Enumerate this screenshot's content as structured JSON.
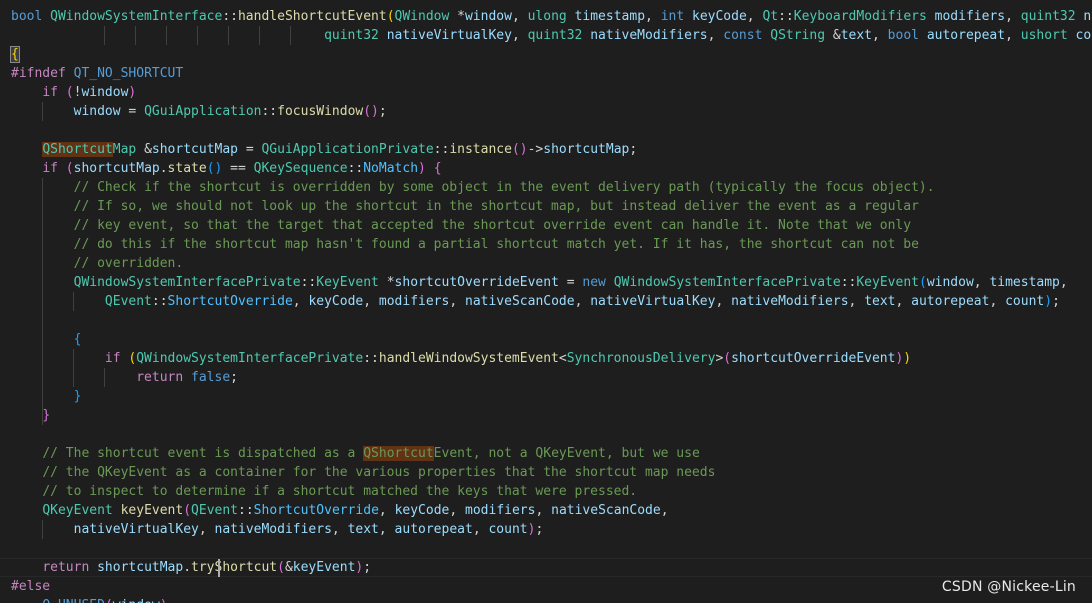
{
  "colors": {
    "background": "#1e1e1e",
    "keyword": "#569cd6",
    "control": "#c586c0",
    "type": "#4ec9b0",
    "function": "#dcdcaa",
    "variable": "#9cdcfe",
    "comment": "#6a9955",
    "text": "#d4d4d4",
    "enum_member": "#4fc1ff",
    "bracket_gold": "#ffd700",
    "bracket_purple": "#da70d6",
    "bracket_blue": "#179fff",
    "search_highlight": "#613214"
  },
  "code_lines": [
    [
      [
        "bool",
        "#569cd6"
      ],
      [
        " ",
        "#d4d4d4"
      ],
      [
        "QWindowSystemInterface",
        "#4ec9b0"
      ],
      [
        "::",
        "#d4d4d4"
      ],
      [
        "handleShortcutEvent",
        "#dcdcaa"
      ],
      [
        "(",
        "#ffd700"
      ],
      [
        "QWindow",
        "#4ec9b0"
      ],
      [
        " *",
        "#d4d4d4"
      ],
      [
        "window",
        "#9cdcfe"
      ],
      [
        ", ",
        "#d4d4d4"
      ],
      [
        "ulong",
        "#4ec9b0"
      ],
      [
        " ",
        "#d4d4d4"
      ],
      [
        "timestamp",
        "#9cdcfe"
      ],
      [
        ", ",
        "#d4d4d4"
      ],
      [
        "int",
        "#569cd6"
      ],
      [
        " ",
        "#d4d4d4"
      ],
      [
        "keyCode",
        "#9cdcfe"
      ],
      [
        ", ",
        "#d4d4d4"
      ],
      [
        "Qt",
        "#4ec9b0"
      ],
      [
        "::",
        "#d4d4d4"
      ],
      [
        "KeyboardModifiers",
        "#4ec9b0"
      ],
      [
        " ",
        "#d4d4d4"
      ],
      [
        "modifiers",
        "#9cdcfe"
      ],
      [
        ", ",
        "#d4d4d4"
      ],
      [
        "quint32",
        "#4ec9b0"
      ],
      [
        " ",
        "#d4d4d4"
      ],
      [
        "nati",
        "#9cdcfe"
      ]
    ],
    [
      [
        "                                        ",
        "#d4d4d4"
      ],
      [
        "quint32",
        "#4ec9b0"
      ],
      [
        " ",
        "#d4d4d4"
      ],
      [
        "nativeVirtualKey",
        "#9cdcfe"
      ],
      [
        ", ",
        "#d4d4d4"
      ],
      [
        "quint32",
        "#4ec9b0"
      ],
      [
        " ",
        "#d4d4d4"
      ],
      [
        "nativeModifiers",
        "#9cdcfe"
      ],
      [
        ", ",
        "#d4d4d4"
      ],
      [
        "const",
        "#569cd6"
      ],
      [
        " ",
        "#d4d4d4"
      ],
      [
        "QString",
        "#4ec9b0"
      ],
      [
        " &",
        "#d4d4d4"
      ],
      [
        "text",
        "#9cdcfe"
      ],
      [
        ", ",
        "#d4d4d4"
      ],
      [
        "bool",
        "#569cd6"
      ],
      [
        " ",
        "#d4d4d4"
      ],
      [
        "autorepeat",
        "#9cdcfe"
      ],
      [
        ", ",
        "#d4d4d4"
      ],
      [
        "ushort",
        "#4ec9b0"
      ],
      [
        " ",
        "#d4d4d4"
      ],
      [
        "count",
        "#9cdcfe"
      ],
      [
        ")",
        "#ffd700"
      ]
    ],
    [
      [
        "{",
        "#ffd700"
      ]
    ],
    [
      [
        "#ifndef",
        "#c586c0"
      ],
      [
        " ",
        "#d4d4d4"
      ],
      [
        "QT_NO_SHORTCUT",
        "#569cd6"
      ]
    ],
    [
      [
        "    ",
        "#d4d4d4"
      ],
      [
        "if",
        "#c586c0"
      ],
      [
        " ",
        "#d4d4d4"
      ],
      [
        "(",
        "#da70d6"
      ],
      [
        "!",
        "#d4d4d4"
      ],
      [
        "window",
        "#9cdcfe"
      ],
      [
        ")",
        "#da70d6"
      ]
    ],
    [
      [
        "        ",
        "#d4d4d4"
      ],
      [
        "window",
        "#9cdcfe"
      ],
      [
        " = ",
        "#d4d4d4"
      ],
      [
        "QGuiApplication",
        "#4ec9b0"
      ],
      [
        "::",
        "#d4d4d4"
      ],
      [
        "focusWindow",
        "#dcdcaa"
      ],
      [
        "()",
        "#da70d6"
      ],
      [
        ";",
        "#d4d4d4"
      ]
    ],
    [
      [
        "",
        "#d4d4d4"
      ]
    ],
    [
      [
        "    ",
        "#d4d4d4"
      ],
      [
        "QShortcut",
        "#4ec9b0"
      ],
      [
        "Map",
        "#4ec9b0"
      ],
      [
        " &",
        "#d4d4d4"
      ],
      [
        "shortcutMap",
        "#9cdcfe"
      ],
      [
        " = ",
        "#d4d4d4"
      ],
      [
        "QGuiApplicationPrivate",
        "#4ec9b0"
      ],
      [
        "::",
        "#d4d4d4"
      ],
      [
        "instance",
        "#dcdcaa"
      ],
      [
        "()",
        "#da70d6"
      ],
      [
        "->",
        "#d4d4d4"
      ],
      [
        "shortcutMap",
        "#9cdcfe"
      ],
      [
        ";",
        "#d4d4d4"
      ]
    ],
    [
      [
        "    ",
        "#d4d4d4"
      ],
      [
        "if",
        "#c586c0"
      ],
      [
        " ",
        "#d4d4d4"
      ],
      [
        "(",
        "#da70d6"
      ],
      [
        "shortcutMap",
        "#9cdcfe"
      ],
      [
        ".",
        "#d4d4d4"
      ],
      [
        "state",
        "#dcdcaa"
      ],
      [
        "()",
        "#179fff"
      ],
      [
        " == ",
        "#d4d4d4"
      ],
      [
        "QKeySequence",
        "#4ec9b0"
      ],
      [
        "::",
        "#d4d4d4"
      ],
      [
        "NoMatch",
        "#4fc1ff"
      ],
      [
        ")",
        "#da70d6"
      ],
      [
        " ",
        "#d4d4d4"
      ],
      [
        "{",
        "#da70d6"
      ]
    ],
    [
      [
        "        ",
        "#d4d4d4"
      ],
      [
        "// Check if the shortcut is overridden by some object in the event delivery path (typically the focus object).",
        "#6a9955"
      ]
    ],
    [
      [
        "        ",
        "#d4d4d4"
      ],
      [
        "// If so, we should not look up the shortcut in the shortcut map, but instead deliver the event as a regular",
        "#6a9955"
      ]
    ],
    [
      [
        "        ",
        "#d4d4d4"
      ],
      [
        "// key event, so that the target that accepted the shortcut override event can handle it. Note that we only",
        "#6a9955"
      ]
    ],
    [
      [
        "        ",
        "#d4d4d4"
      ],
      [
        "// do this if the shortcut map hasn't found a partial shortcut match yet. If it has, the shortcut can not be",
        "#6a9955"
      ]
    ],
    [
      [
        "        ",
        "#d4d4d4"
      ],
      [
        "// overridden.",
        "#6a9955"
      ]
    ],
    [
      [
        "        ",
        "#d4d4d4"
      ],
      [
        "QWindowSystemInterfacePrivate",
        "#4ec9b0"
      ],
      [
        "::",
        "#d4d4d4"
      ],
      [
        "KeyEvent",
        "#4ec9b0"
      ],
      [
        " *",
        "#d4d4d4"
      ],
      [
        "shortcutOverrideEvent",
        "#9cdcfe"
      ],
      [
        " = ",
        "#d4d4d4"
      ],
      [
        "new",
        "#569cd6"
      ],
      [
        " ",
        "#d4d4d4"
      ],
      [
        "QWindowSystemInterfacePrivate",
        "#4ec9b0"
      ],
      [
        "::",
        "#d4d4d4"
      ],
      [
        "KeyEvent",
        "#4ec9b0"
      ],
      [
        "(",
        "#179fff"
      ],
      [
        "window",
        "#9cdcfe"
      ],
      [
        ", ",
        "#d4d4d4"
      ],
      [
        "timestamp",
        "#9cdcfe"
      ],
      [
        ",",
        "#d4d4d4"
      ]
    ],
    [
      [
        "            ",
        "#d4d4d4"
      ],
      [
        "QEvent",
        "#4ec9b0"
      ],
      [
        "::",
        "#d4d4d4"
      ],
      [
        "ShortcutOverride",
        "#4fc1ff"
      ],
      [
        ", ",
        "#d4d4d4"
      ],
      [
        "keyCode",
        "#9cdcfe"
      ],
      [
        ", ",
        "#d4d4d4"
      ],
      [
        "modifiers",
        "#9cdcfe"
      ],
      [
        ", ",
        "#d4d4d4"
      ],
      [
        "nativeScanCode",
        "#9cdcfe"
      ],
      [
        ", ",
        "#d4d4d4"
      ],
      [
        "nativeVirtualKey",
        "#9cdcfe"
      ],
      [
        ", ",
        "#d4d4d4"
      ],
      [
        "nativeModifiers",
        "#9cdcfe"
      ],
      [
        ", ",
        "#d4d4d4"
      ],
      [
        "text",
        "#9cdcfe"
      ],
      [
        ", ",
        "#d4d4d4"
      ],
      [
        "autorepeat",
        "#9cdcfe"
      ],
      [
        ", ",
        "#d4d4d4"
      ],
      [
        "count",
        "#9cdcfe"
      ],
      [
        ")",
        "#179fff"
      ],
      [
        ";",
        "#d4d4d4"
      ]
    ],
    [
      [
        "",
        "#d4d4d4"
      ]
    ],
    [
      [
        "        ",
        "#d4d4d4"
      ],
      [
        "{",
        "#179fff"
      ]
    ],
    [
      [
        "            ",
        "#d4d4d4"
      ],
      [
        "if",
        "#c586c0"
      ],
      [
        " ",
        "#d4d4d4"
      ],
      [
        "(",
        "#ffd700"
      ],
      [
        "QWindowSystemInterfacePrivate",
        "#4ec9b0"
      ],
      [
        "::",
        "#d4d4d4"
      ],
      [
        "handleWindowSystemEvent",
        "#dcdcaa"
      ],
      [
        "<",
        "#d4d4d4"
      ],
      [
        "SynchronousDelivery",
        "#4ec9b0"
      ],
      [
        ">",
        "#d4d4d4"
      ],
      [
        "(",
        "#da70d6"
      ],
      [
        "shortcutOverrideEvent",
        "#9cdcfe"
      ],
      [
        ")",
        "#da70d6"
      ],
      [
        ")",
        "#ffd700"
      ]
    ],
    [
      [
        "                ",
        "#d4d4d4"
      ],
      [
        "return",
        "#c586c0"
      ],
      [
        " ",
        "#d4d4d4"
      ],
      [
        "false",
        "#569cd6"
      ],
      [
        ";",
        "#d4d4d4"
      ]
    ],
    [
      [
        "        ",
        "#d4d4d4"
      ],
      [
        "}",
        "#179fff"
      ]
    ],
    [
      [
        "    ",
        "#d4d4d4"
      ],
      [
        "}",
        "#da70d6"
      ]
    ],
    [
      [
        "",
        "#d4d4d4"
      ]
    ],
    [
      [
        "    ",
        "#d4d4d4"
      ],
      [
        "// The shortcut event is dispatched as a ",
        "#6a9955"
      ],
      [
        "QShortcut",
        "#6a9955"
      ],
      [
        "Event, not a QKeyEvent, but we use",
        "#6a9955"
      ]
    ],
    [
      [
        "    ",
        "#d4d4d4"
      ],
      [
        "// the QKeyEvent as a container for the various properties that the shortcut map needs",
        "#6a9955"
      ]
    ],
    [
      [
        "    ",
        "#d4d4d4"
      ],
      [
        "// to inspect to determine if a shortcut matched the keys that were pressed.",
        "#6a9955"
      ]
    ],
    [
      [
        "    ",
        "#d4d4d4"
      ],
      [
        "QKeyEvent",
        "#4ec9b0"
      ],
      [
        " ",
        "#d4d4d4"
      ],
      [
        "keyEvent",
        "#dcdcaa"
      ],
      [
        "(",
        "#da70d6"
      ],
      [
        "QEvent",
        "#4ec9b0"
      ],
      [
        "::",
        "#d4d4d4"
      ],
      [
        "ShortcutOverride",
        "#4fc1ff"
      ],
      [
        ", ",
        "#d4d4d4"
      ],
      [
        "keyCode",
        "#9cdcfe"
      ],
      [
        ", ",
        "#d4d4d4"
      ],
      [
        "modifiers",
        "#9cdcfe"
      ],
      [
        ", ",
        "#d4d4d4"
      ],
      [
        "nativeScanCode",
        "#9cdcfe"
      ],
      [
        ",",
        "#d4d4d4"
      ]
    ],
    [
      [
        "        ",
        "#d4d4d4"
      ],
      [
        "nativeVirtualKey",
        "#9cdcfe"
      ],
      [
        ", ",
        "#d4d4d4"
      ],
      [
        "nativeModifiers",
        "#9cdcfe"
      ],
      [
        ", ",
        "#d4d4d4"
      ],
      [
        "text",
        "#9cdcfe"
      ],
      [
        ", ",
        "#d4d4d4"
      ],
      [
        "autorepeat",
        "#9cdcfe"
      ],
      [
        ", ",
        "#d4d4d4"
      ],
      [
        "count",
        "#9cdcfe"
      ],
      [
        ")",
        "#da70d6"
      ],
      [
        ";",
        "#d4d4d4"
      ]
    ],
    [
      [
        "",
        "#d4d4d4"
      ]
    ],
    [
      [
        "    ",
        "#d4d4d4"
      ],
      [
        "return",
        "#c586c0"
      ],
      [
        " ",
        "#d4d4d4"
      ],
      [
        "shortcutMap",
        "#9cdcfe"
      ],
      [
        ".",
        "#d4d4d4"
      ],
      [
        "tryShortcut",
        "#dcdcaa"
      ],
      [
        "(",
        "#da70d6"
      ],
      [
        "&",
        "#d4d4d4"
      ],
      [
        "keyEvent",
        "#9cdcfe"
      ],
      [
        ")",
        "#da70d6"
      ],
      [
        ";",
        "#d4d4d4"
      ]
    ],
    [
      [
        "#else",
        "#c586c0"
      ]
    ],
    [
      [
        "    ",
        "#d4d4d4"
      ],
      [
        "Q_UNUSED",
        "#569cd6"
      ],
      [
        "(",
        "#da70d6"
      ],
      [
        "window",
        "#9cdcfe"
      ],
      [
        ")",
        "#da70d6"
      ]
    ]
  ],
  "watermark": "CSDN @Nickee-Lin"
}
